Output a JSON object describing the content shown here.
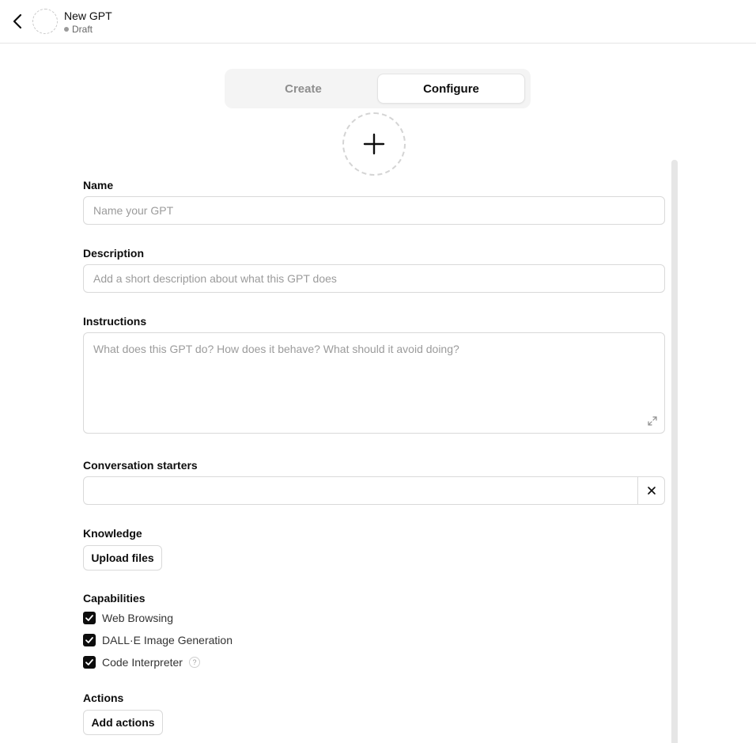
{
  "header": {
    "name": "New GPT",
    "status": "Draft"
  },
  "tabs": {
    "create": "Create",
    "configure": "Configure",
    "active": "configure"
  },
  "form": {
    "name": {
      "label": "Name",
      "placeholder": "Name your GPT",
      "value": ""
    },
    "description": {
      "label": "Description",
      "placeholder": "Add a short description about what this GPT does",
      "value": ""
    },
    "instructions": {
      "label": "Instructions",
      "placeholder": "What does this GPT do? How does it behave? What should it avoid doing?",
      "value": ""
    },
    "conversation_starters": {
      "label": "Conversation starters",
      "value": ""
    },
    "knowledge": {
      "label": "Knowledge",
      "button": "Upload files"
    },
    "capabilities": {
      "label": "Capabilities",
      "items": [
        {
          "label": "Web Browsing",
          "checked": true
        },
        {
          "label": "DALL·E Image Generation",
          "checked": true
        },
        {
          "label": "Code Interpreter",
          "checked": true,
          "help": "?"
        }
      ]
    },
    "actions": {
      "label": "Actions",
      "button": "Add actions"
    }
  },
  "icons": {
    "back": "chevron-left-icon",
    "avatar_upload": "plus-icon",
    "expand": "expand-icon",
    "clear": "close-icon",
    "check": "checkmark-icon",
    "help": "question-circle-icon"
  },
  "colors": {
    "text": "#0d0d0d",
    "muted": "#9b9b9b",
    "border": "#d9d9d9",
    "tab_bg": "#f4f4f4",
    "checkbox": "#0d0d0d"
  }
}
